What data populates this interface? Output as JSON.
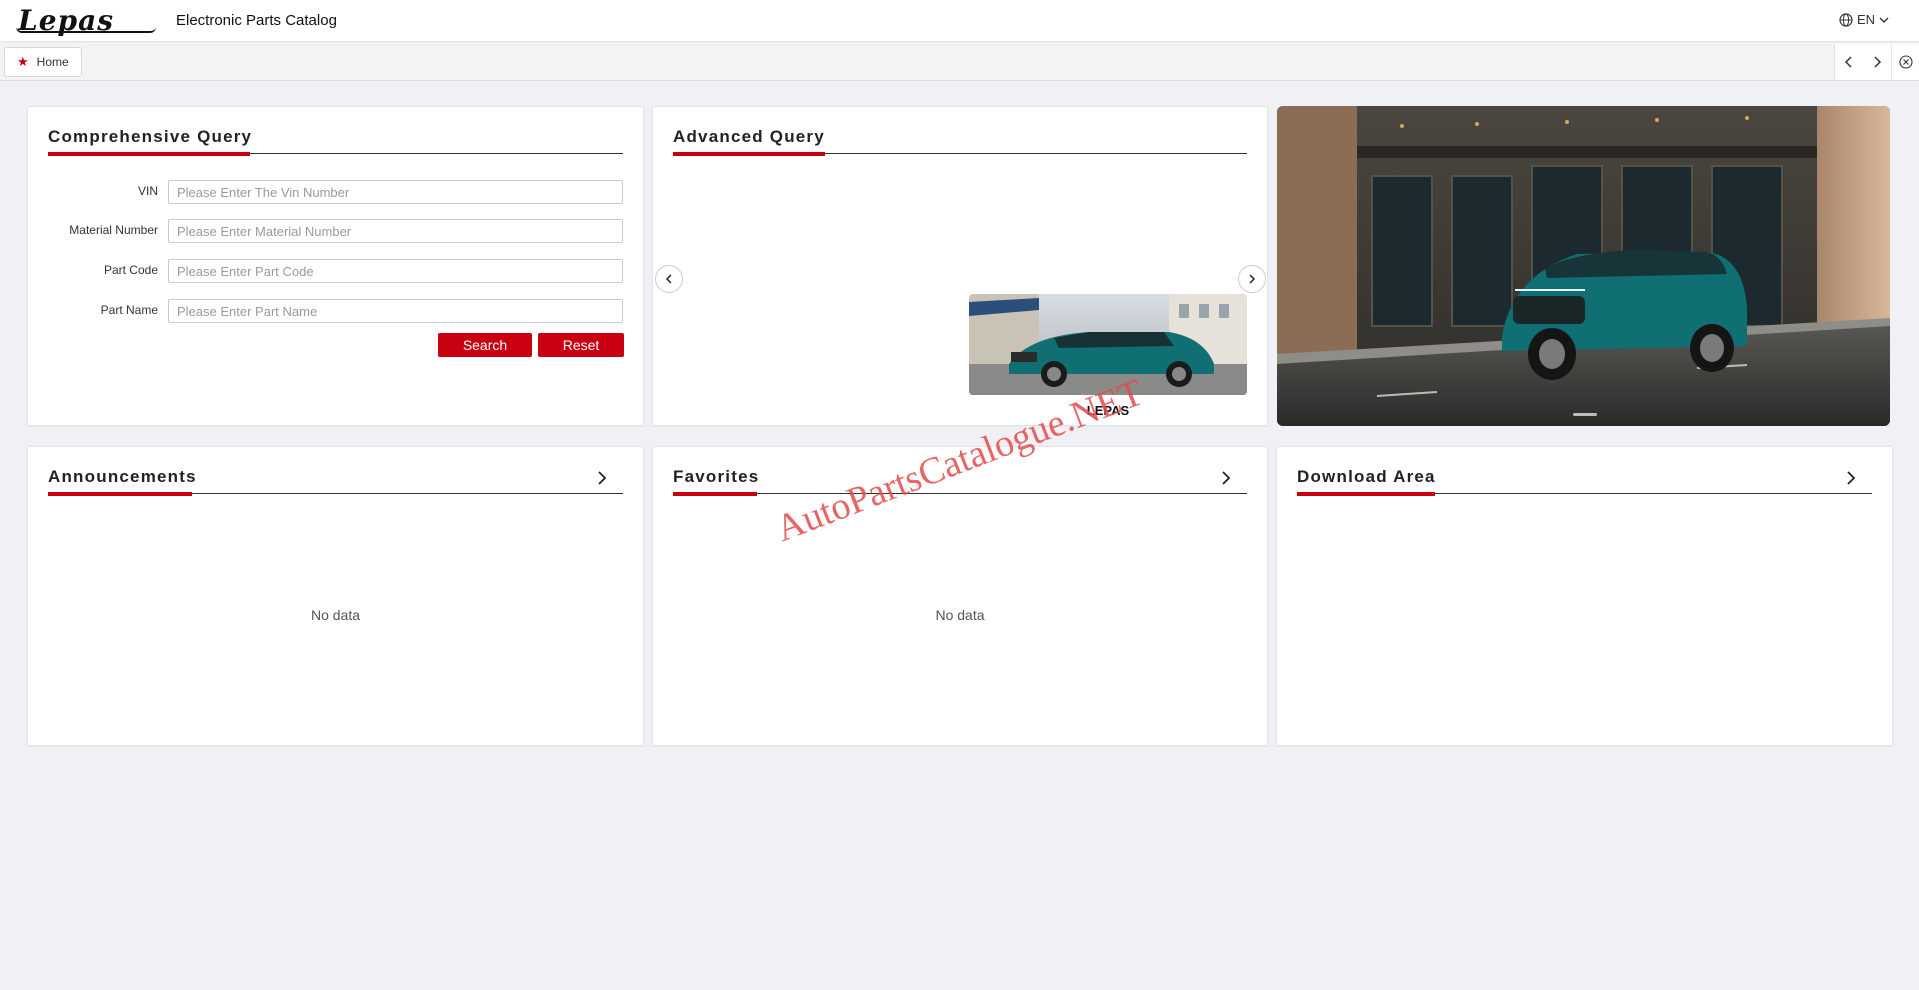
{
  "header": {
    "brand": "Lepas",
    "app_title": "Electronic Parts Catalog",
    "language": "EN",
    "globe_icon": "globe-icon",
    "chevron_icon": "chevron-down-icon"
  },
  "tabs": {
    "home_label": "Home",
    "home_icon": "star-icon"
  },
  "comprehensive": {
    "title": "Comprehensive Query",
    "fields": [
      {
        "label": "VIN",
        "placeholder": "Please Enter The Vin Number"
      },
      {
        "label": "Material Number",
        "placeholder": "Please Enter Material Number"
      },
      {
        "label": "Part Code",
        "placeholder": "Please Enter Part Code"
      },
      {
        "label": "Part Name",
        "placeholder": "Please Enter Part Name"
      }
    ],
    "search_label": "Search",
    "reset_label": "Reset"
  },
  "advanced": {
    "title": "Advanced Query",
    "vehicles": [
      {
        "label": "LEPAS"
      }
    ]
  },
  "announcements": {
    "title": "Announcements",
    "empty_text": "No data"
  },
  "favorites": {
    "title": "Favorites",
    "empty_text": "No data"
  },
  "download": {
    "title": "Download Area"
  },
  "watermark": "AutoPartsCatalogue.NET",
  "colors": {
    "accent": "#c8000f",
    "background": "#f0f1f5",
    "car_teal": "#0f6f73"
  }
}
